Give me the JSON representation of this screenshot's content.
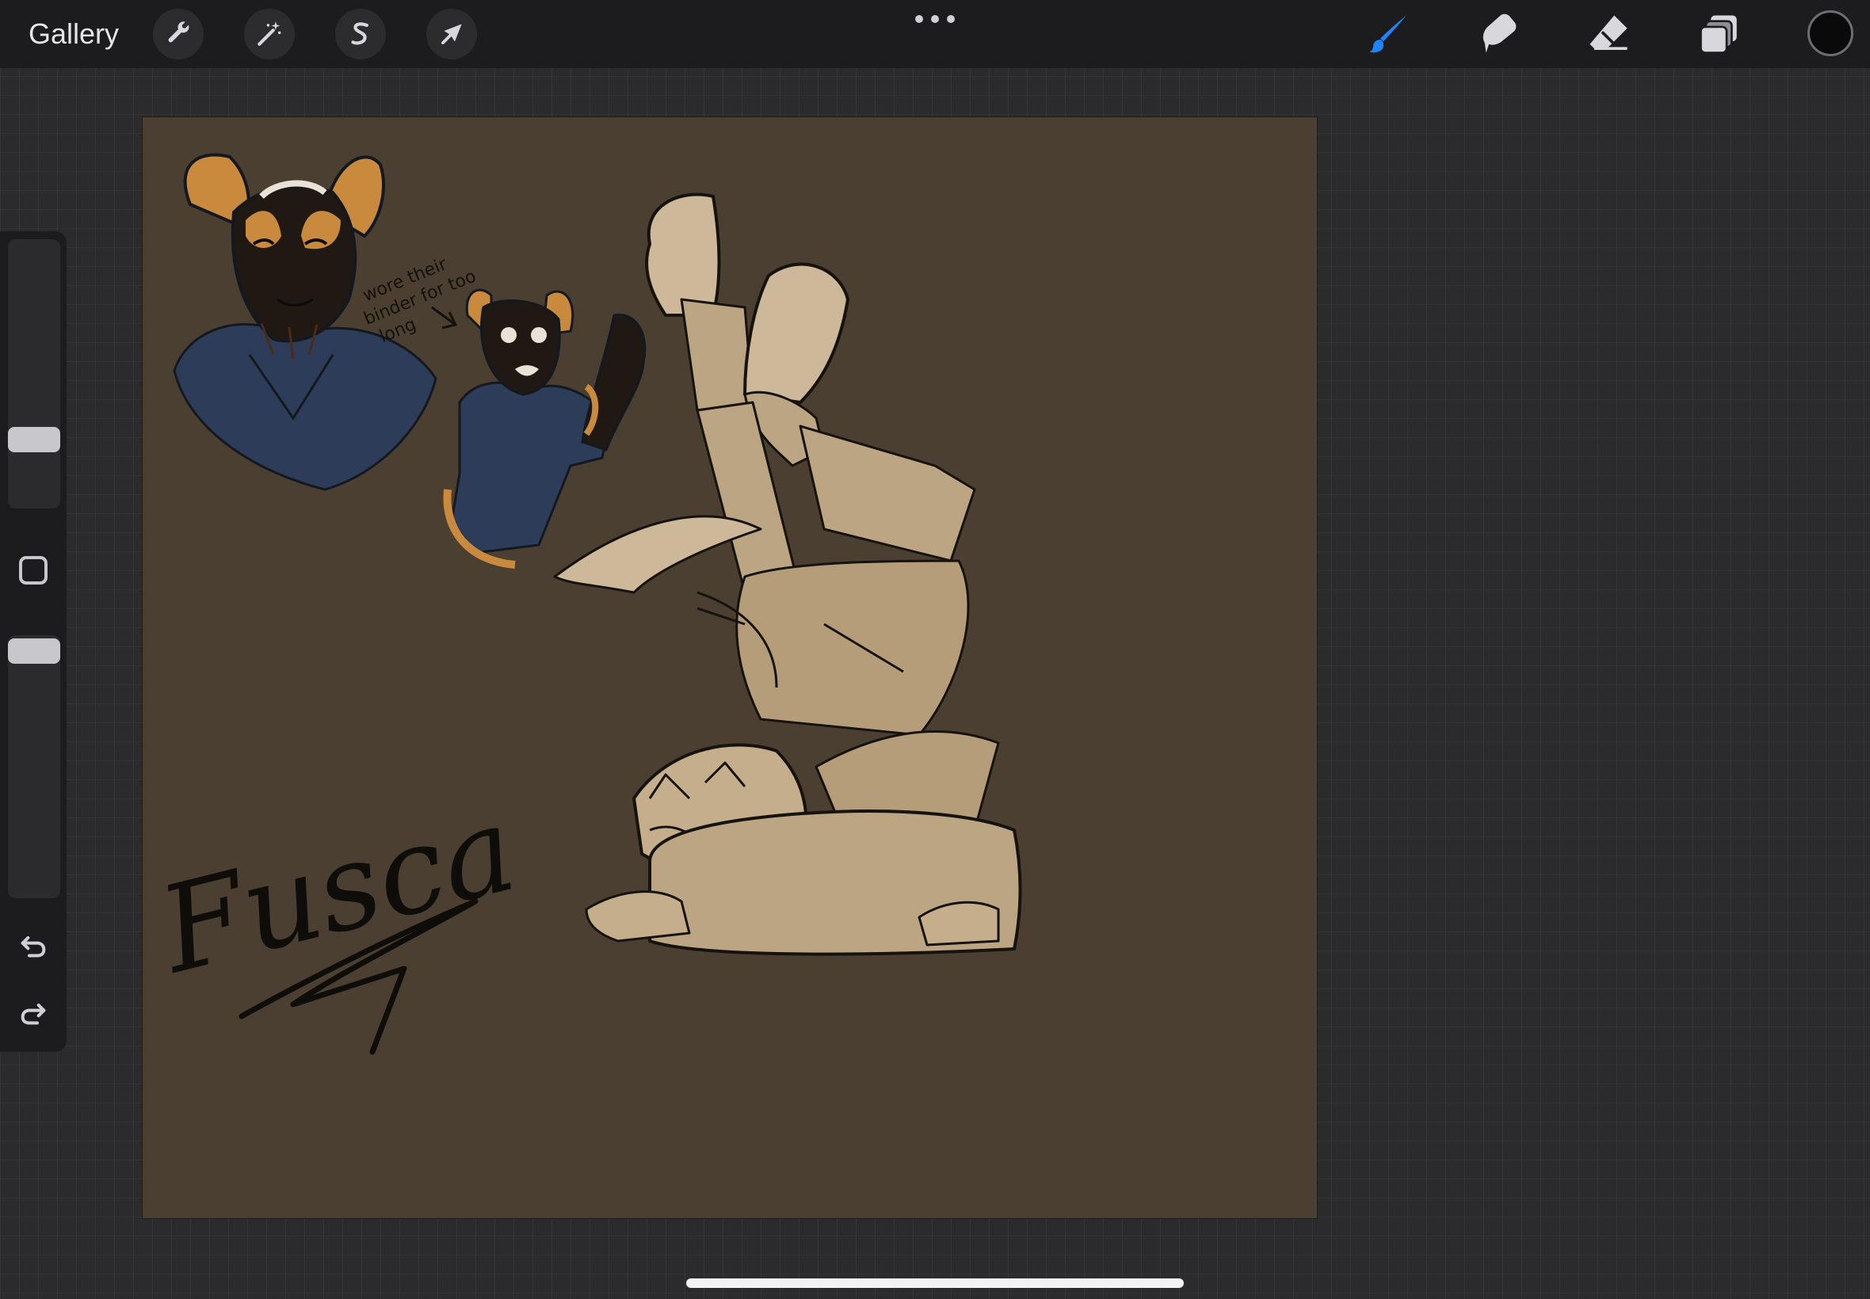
{
  "topbar": {
    "gallery_label": "Gallery",
    "left_tools": [
      {
        "name": "actions",
        "icon": "wrench-icon"
      },
      {
        "name": "adjustments",
        "icon": "magic-wand-icon"
      },
      {
        "name": "selection",
        "icon": "selection-s-icon"
      },
      {
        "name": "transform",
        "icon": "arrow-cursor-icon"
      }
    ],
    "more_icon": "ellipsis-icon",
    "right_tools": [
      {
        "name": "brush",
        "icon": "brush-icon",
        "active": true
      },
      {
        "name": "smudge",
        "icon": "smudge-icon",
        "active": false
      },
      {
        "name": "eraser",
        "icon": "eraser-icon",
        "active": false
      },
      {
        "name": "layers",
        "icon": "layers-icon",
        "active": false
      }
    ],
    "current_color": "#0a0a0a",
    "active_color": "#1e84ff"
  },
  "sidebar": {
    "brush_size_level": 0.3,
    "brush_opacity_level": 0.1,
    "modify_icon": "square-icon",
    "undo_icon": "undo-icon",
    "redo_icon": "redo-icon"
  },
  "canvas": {
    "background": "#4a3f31",
    "note": [
      "wore their",
      "binder for too",
      "long"
    ],
    "signature": "Fusca"
  }
}
